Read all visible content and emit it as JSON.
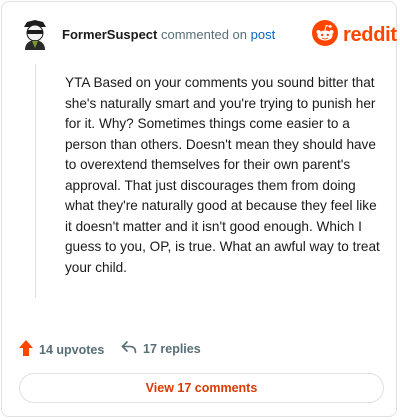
{
  "comment": {
    "username": "FormerSuspect",
    "action": "commented on",
    "target": "post",
    "body": "YTA Based on your comments you sound bitter that she's naturally smart and you're trying to punish her for it. Why? Sometimes things come easier to a person than others. Doesn't mean they should have to overextend themselves for their own parent's approval. That just discourages them from doing what they're naturally good at because they feel like it doesn't matter and it isn't good enough. Which I guess to you, OP, is true. What an awful way to treat your child."
  },
  "brand": {
    "name": "reddit",
    "color": "#ff4500"
  },
  "footer": {
    "upvotes_label": "14 upvotes",
    "replies_label": "17 replies",
    "view_comments_label": "View 17 comments"
  },
  "icons": {
    "avatar": "avatar-icon",
    "logo": "reddit-snoo-icon",
    "upvote": "upvote-arrow-icon",
    "reply": "reply-arrow-icon"
  },
  "colors": {
    "upvote": "#ff4500",
    "link": "#0a65c2",
    "button_text": "#d93a00",
    "muted": "#576f76"
  }
}
